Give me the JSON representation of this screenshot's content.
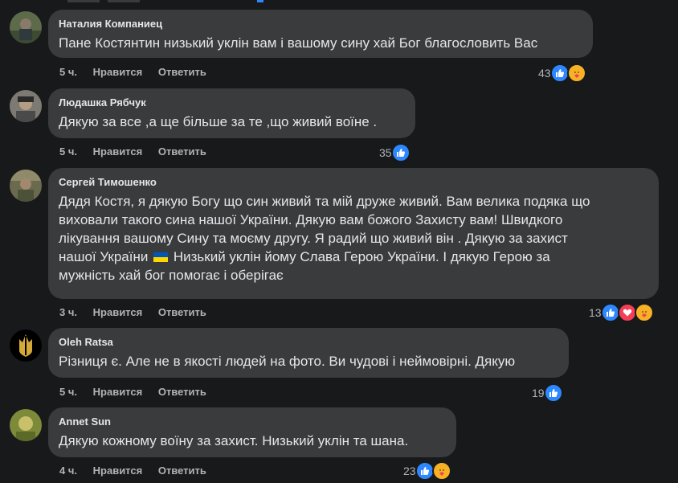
{
  "comments": [
    {
      "author": "Наталия Компаниец",
      "text": "Пане Костянтин низький уклін вам і вашому сину хай Бог благословить Вас",
      "time": "5 ч.",
      "like_label": "Нравится",
      "reply_label": "Ответить",
      "reaction_count": "43",
      "reactions": [
        "like",
        "care"
      ]
    },
    {
      "author": "Людашка Рябчук",
      "text": "Дякую за все ,а ще більше за те ,що живий воїне .",
      "time": "5 ч.",
      "like_label": "Нравится",
      "reply_label": "Ответить",
      "reaction_count": "35",
      "reactions": [
        "like"
      ]
    },
    {
      "author": "Сергей Тимошенко",
      "text_lines": [
        "Дядя Костя, я дякую Богу що син живий та мій друже живий. Вам велика подяка що",
        "виховали такого сина нашої України. Дякую вам божого Захисту вам! Швидкого",
        "лікування вашому Сину та моєму другу. Я радий що живий він . Дякую за захист",
        "нашої України",
        "Низький уклін йому Слава Герою України. І дякую Герою за",
        "мужність хай бог помогає і оберігає"
      ],
      "time": "3 ч.",
      "like_label": "Нравится",
      "reply_label": "Ответить",
      "reaction_count": "13",
      "reactions": [
        "like",
        "love",
        "care"
      ]
    },
    {
      "author": "Oleh Ratsa",
      "text": "Різниця є. Але не в якості людей на фото. Ви чудові і неймовірні. Дякую",
      "time": "5 ч.",
      "like_label": "Нравится",
      "reply_label": "Ответить",
      "reaction_count": "19",
      "reactions": [
        "like"
      ]
    },
    {
      "author": "Annet Sun",
      "text": "Дякую кожному воїну за захист. Низький уклін та шана.",
      "time": "4 ч.",
      "like_label": "Нравится",
      "reply_label": "Ответить",
      "reaction_count": "23",
      "reactions": [
        "like",
        "care"
      ]
    }
  ],
  "colors": {
    "background": "#18191a",
    "bubble": "#3a3b3c",
    "text": "#e4e6eb",
    "secondary": "#b0b3b8",
    "like": "#2d88ff",
    "love": "#f33e58",
    "care": "#f7b125"
  }
}
